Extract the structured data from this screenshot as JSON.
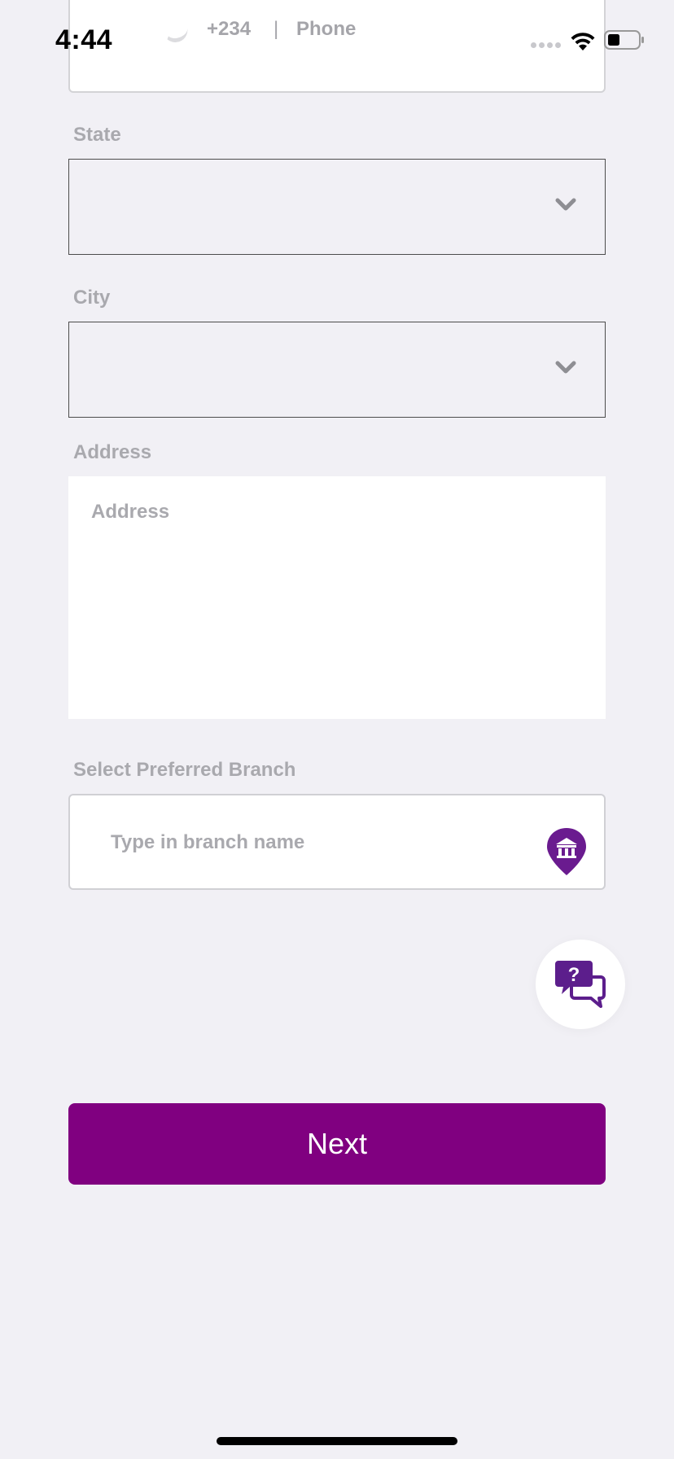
{
  "status_bar": {
    "time": "4:44"
  },
  "phone": {
    "code": "+234",
    "separator": "|",
    "placeholder": "Phone"
  },
  "state": {
    "label": "State",
    "value": ""
  },
  "city": {
    "label": "City",
    "value": ""
  },
  "address": {
    "label": "Address",
    "placeholder": "Address"
  },
  "branch": {
    "label": "Select Preferred Branch",
    "placeholder": "Type in branch name"
  },
  "actions": {
    "next_label": "Next"
  },
  "icons": {
    "chevron": "chevron-down-icon",
    "branch_pin": "bank-location-pin-icon",
    "help": "help-chat-icon"
  },
  "colors": {
    "brand": "#800080",
    "icon_purple": "#5c1e8c"
  }
}
